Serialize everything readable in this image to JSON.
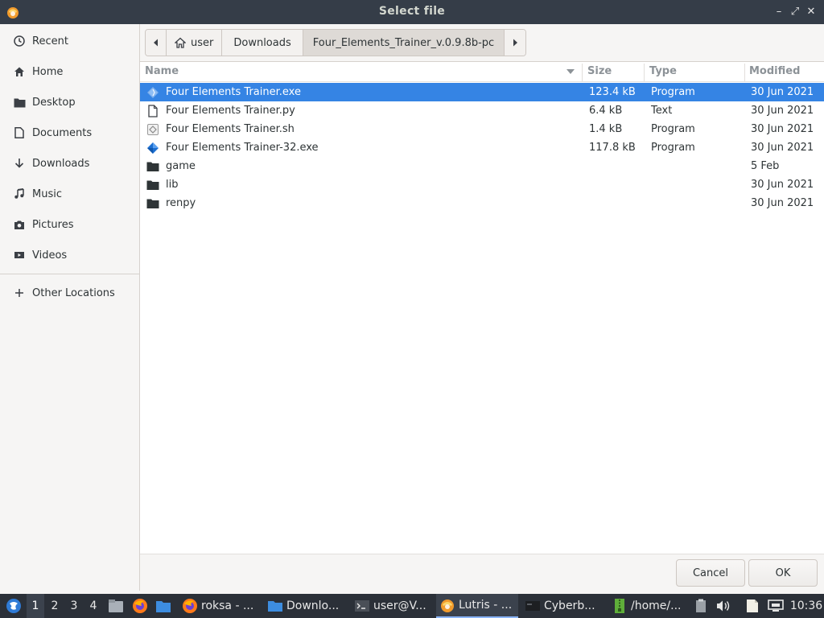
{
  "window": {
    "title": "Select file",
    "controls": {
      "minimize": "–",
      "restore": "⤢",
      "close": "✕"
    }
  },
  "sidebar": {
    "items": [
      {
        "label": "Recent",
        "icon": "clock-icon"
      },
      {
        "label": "Home",
        "icon": "home-icon"
      },
      {
        "label": "Desktop",
        "icon": "folder-icon"
      },
      {
        "label": "Documents",
        "icon": "document-icon"
      },
      {
        "label": "Downloads",
        "icon": "download-icon"
      },
      {
        "label": "Music",
        "icon": "music-icon"
      },
      {
        "label": "Pictures",
        "icon": "camera-icon"
      },
      {
        "label": "Videos",
        "icon": "video-icon"
      }
    ],
    "other_locations": {
      "label": "Other Locations",
      "icon": "plus-icon"
    }
  },
  "pathbar": {
    "segments": [
      {
        "label": "user",
        "icon": "home-icon"
      },
      {
        "label": "Downloads"
      },
      {
        "label": "Four_Elements_Trainer_v.0.9.8b-pc"
      }
    ]
  },
  "filelist": {
    "columns": {
      "name": "Name",
      "size": "Size",
      "type": "Type",
      "modified": "Modified"
    },
    "rows": [
      {
        "name": "Four Elements Trainer.exe",
        "size": "123.4 kB",
        "type": "Program",
        "modified": "30 Jun 2021",
        "icon": "executable-icon",
        "selected": true
      },
      {
        "name": "Four Elements Trainer.py",
        "size": "6.4 kB",
        "type": "Text",
        "modified": "30 Jun 2021",
        "icon": "text-file-icon",
        "selected": false
      },
      {
        "name": "Four Elements Trainer.sh",
        "size": "1.4 kB",
        "type": "Program",
        "modified": "30 Jun 2021",
        "icon": "script-icon",
        "selected": false
      },
      {
        "name": "Four Elements Trainer-32.exe",
        "size": "117.8 kB",
        "type": "Program",
        "modified": "30 Jun 2021",
        "icon": "executable-icon",
        "selected": false
      },
      {
        "name": "game",
        "size": "",
        "type": "",
        "modified": "5 Feb",
        "icon": "folder-icon",
        "selected": false
      },
      {
        "name": "lib",
        "size": "",
        "type": "",
        "modified": "30 Jun 2021",
        "icon": "folder-icon",
        "selected": false
      },
      {
        "name": "renpy",
        "size": "",
        "type": "",
        "modified": "30 Jun 2021",
        "icon": "folder-icon",
        "selected": false
      }
    ]
  },
  "actions": {
    "cancel": "Cancel",
    "ok": "OK"
  },
  "taskbar": {
    "workspaces": [
      "1",
      "2",
      "3",
      "4"
    ],
    "tasks": [
      {
        "label": "roksa - ...",
        "icon": "firefox-icon"
      },
      {
        "label": "Downlo...",
        "icon": "folder-icon"
      },
      {
        "label": "user@V...",
        "icon": "terminal-icon"
      },
      {
        "label": "Lutris - ...",
        "icon": "lutris-icon"
      },
      {
        "label": "Cyberb...",
        "icon": "game-window-icon"
      },
      {
        "label": "/home/...",
        "icon": "archive-icon"
      }
    ],
    "clock": "10:36"
  },
  "colors": {
    "selection": "#3584e4",
    "titlebar": "#353d48",
    "taskbar": "#2b3038"
  }
}
